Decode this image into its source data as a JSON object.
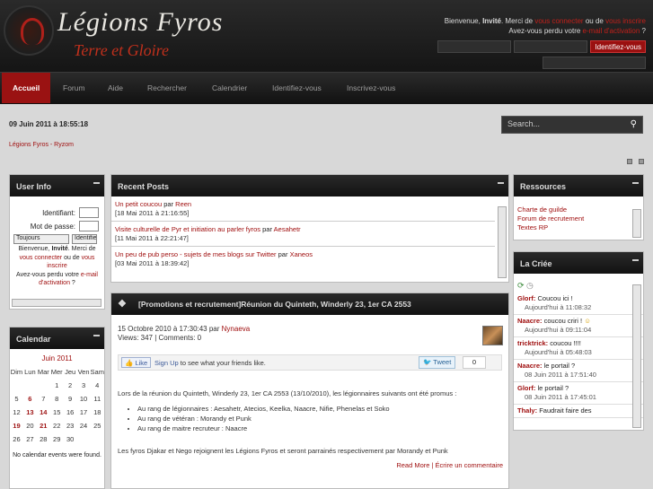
{
  "header": {
    "title": "Légions Fyros",
    "subtitle": "Terre et Gloire",
    "welcome_prefix": "Bienvenue,",
    "guest": "Invité",
    "merci_de": ". Merci de",
    "login_link": "vous connecter",
    "ou_de": "ou de",
    "register_link": "vous inscrire",
    "lost_pw": "Avez-vous perdu votre",
    "activation_link": "e-mail d'activation",
    "login_button": "Identifiez-vous"
  },
  "nav": {
    "items": [
      "Accueil",
      "Forum",
      "Aide",
      "Rechercher",
      "Calendrier",
      "Identifiez-vous",
      "Inscrivez-vous"
    ]
  },
  "date": "09 Juin 2011 à 18:55:18",
  "search_placeholder": "Search...",
  "breadcrumb": "Légions Fyros - Ryzom",
  "userinfo": {
    "title": "User Info",
    "identifiant": "Identifiant:",
    "password": "Mot de passe:",
    "duration": "Toujours",
    "login_btn": "Identifiez-vous",
    "text1": "Bienvenue,",
    "guest": "Invité",
    "text2": ". Merci de",
    "link1": "vous connecter",
    "text3": "ou de",
    "link2": "vous inscrire",
    "text4": "Avez-vous perdu votre",
    "link3": "e-mail d'activation",
    "text5": "?"
  },
  "calendar": {
    "title": "Calendar",
    "month": "Juin 2011",
    "days": [
      "Dim",
      "Lun",
      "Mar",
      "Mer",
      "Jeu",
      "Ven",
      "Sam"
    ],
    "weeks": [
      [
        "",
        "",
        "",
        "1",
        "2",
        "3",
        "4"
      ],
      [
        "5",
        "6",
        "7",
        "8",
        "9",
        "10",
        "11"
      ],
      [
        "12",
        "13",
        "14",
        "15",
        "16",
        "17",
        "18"
      ],
      [
        "19",
        "20",
        "21",
        "22",
        "23",
        "24",
        "25"
      ],
      [
        "26",
        "27",
        "28",
        "29",
        "30",
        "",
        ""
      ]
    ],
    "no_events": "No calendar events were found."
  },
  "recent": {
    "title": "Recent Posts",
    "posts": [
      {
        "link": "Un petit coucou",
        "by": "par",
        "author": "Reen",
        "date": "[18 Mai 2011 à 21:16:55]"
      },
      {
        "link": "Visite culturelle de Pyr et initiation au parler fyros",
        "by": "par",
        "author": "Aesahetr",
        "date": "[11 Mai 2011 à 22:21:47]"
      },
      {
        "link": "Un peu de pub perso - sujets de mes blogs sur Twitter",
        "by": "par",
        "author": "Xaneos",
        "date": "[03 Mai 2011 à 18:39:42]"
      }
    ]
  },
  "article": {
    "title": "[Promotions et recrutement]Réunion du Quinteth, Winderly 23, 1er CA 2553",
    "date": "15 Octobre 2010 à 17:30:43 par",
    "author": "Nynaeva",
    "views": "Views: 347 | Comments: 0",
    "like": "Like",
    "signup": "Sign Up",
    "signup_rest": "to see what your friends like.",
    "tweet": "Tweet",
    "tweet_count": "0",
    "intro": "Lors de la réunion du Quinteth, Winderly 23, 1er CA 2553 (13/10/2010), les légionnaires suivants ont été promus :",
    "items": [
      "Au rang de légionnaires : Aesahetr, Atecios, Keelka, Naacre, Nifie, Phenelas et Soko",
      "Au rang de vétéran : Morandy et Punk",
      "Au rang de maitre recruteur : Naacre"
    ],
    "outro": "Les fyros Djakar et Nego rejoignent les Légions Fyros et seront parrainés respectivement par Morandy et Punk",
    "read_more": "Read More | Écrire un commentaire"
  },
  "resources": {
    "title": "Ressources",
    "links": [
      "Charte de guilde",
      "Forum de recrutement",
      "Textes RP"
    ]
  },
  "criee": {
    "title": "La Criée",
    "messages": [
      {
        "name": "Glorf:",
        "text": "Coucou ici !",
        "time": "Aujourd'hui à 11:08:32"
      },
      {
        "name": "Naacre:",
        "text": "coucou criri !",
        "time": "Aujourd'hui à 09:11:04"
      },
      {
        "name": "tricktrick:",
        "text": "coucou !!!!",
        "time": "Aujourd'hui à 05:48:03"
      },
      {
        "name": "Naacre:",
        "text": "le portail ?",
        "time": "08 Juin 2011 à 17:51:40"
      },
      {
        "name": "Glorf:",
        "text": "le portail ?",
        "time": "08 Juin 2011 à 17:45:01"
      },
      {
        "name": "Thaly:",
        "text": "Faudrait faire des",
        "time": ""
      }
    ]
  }
}
